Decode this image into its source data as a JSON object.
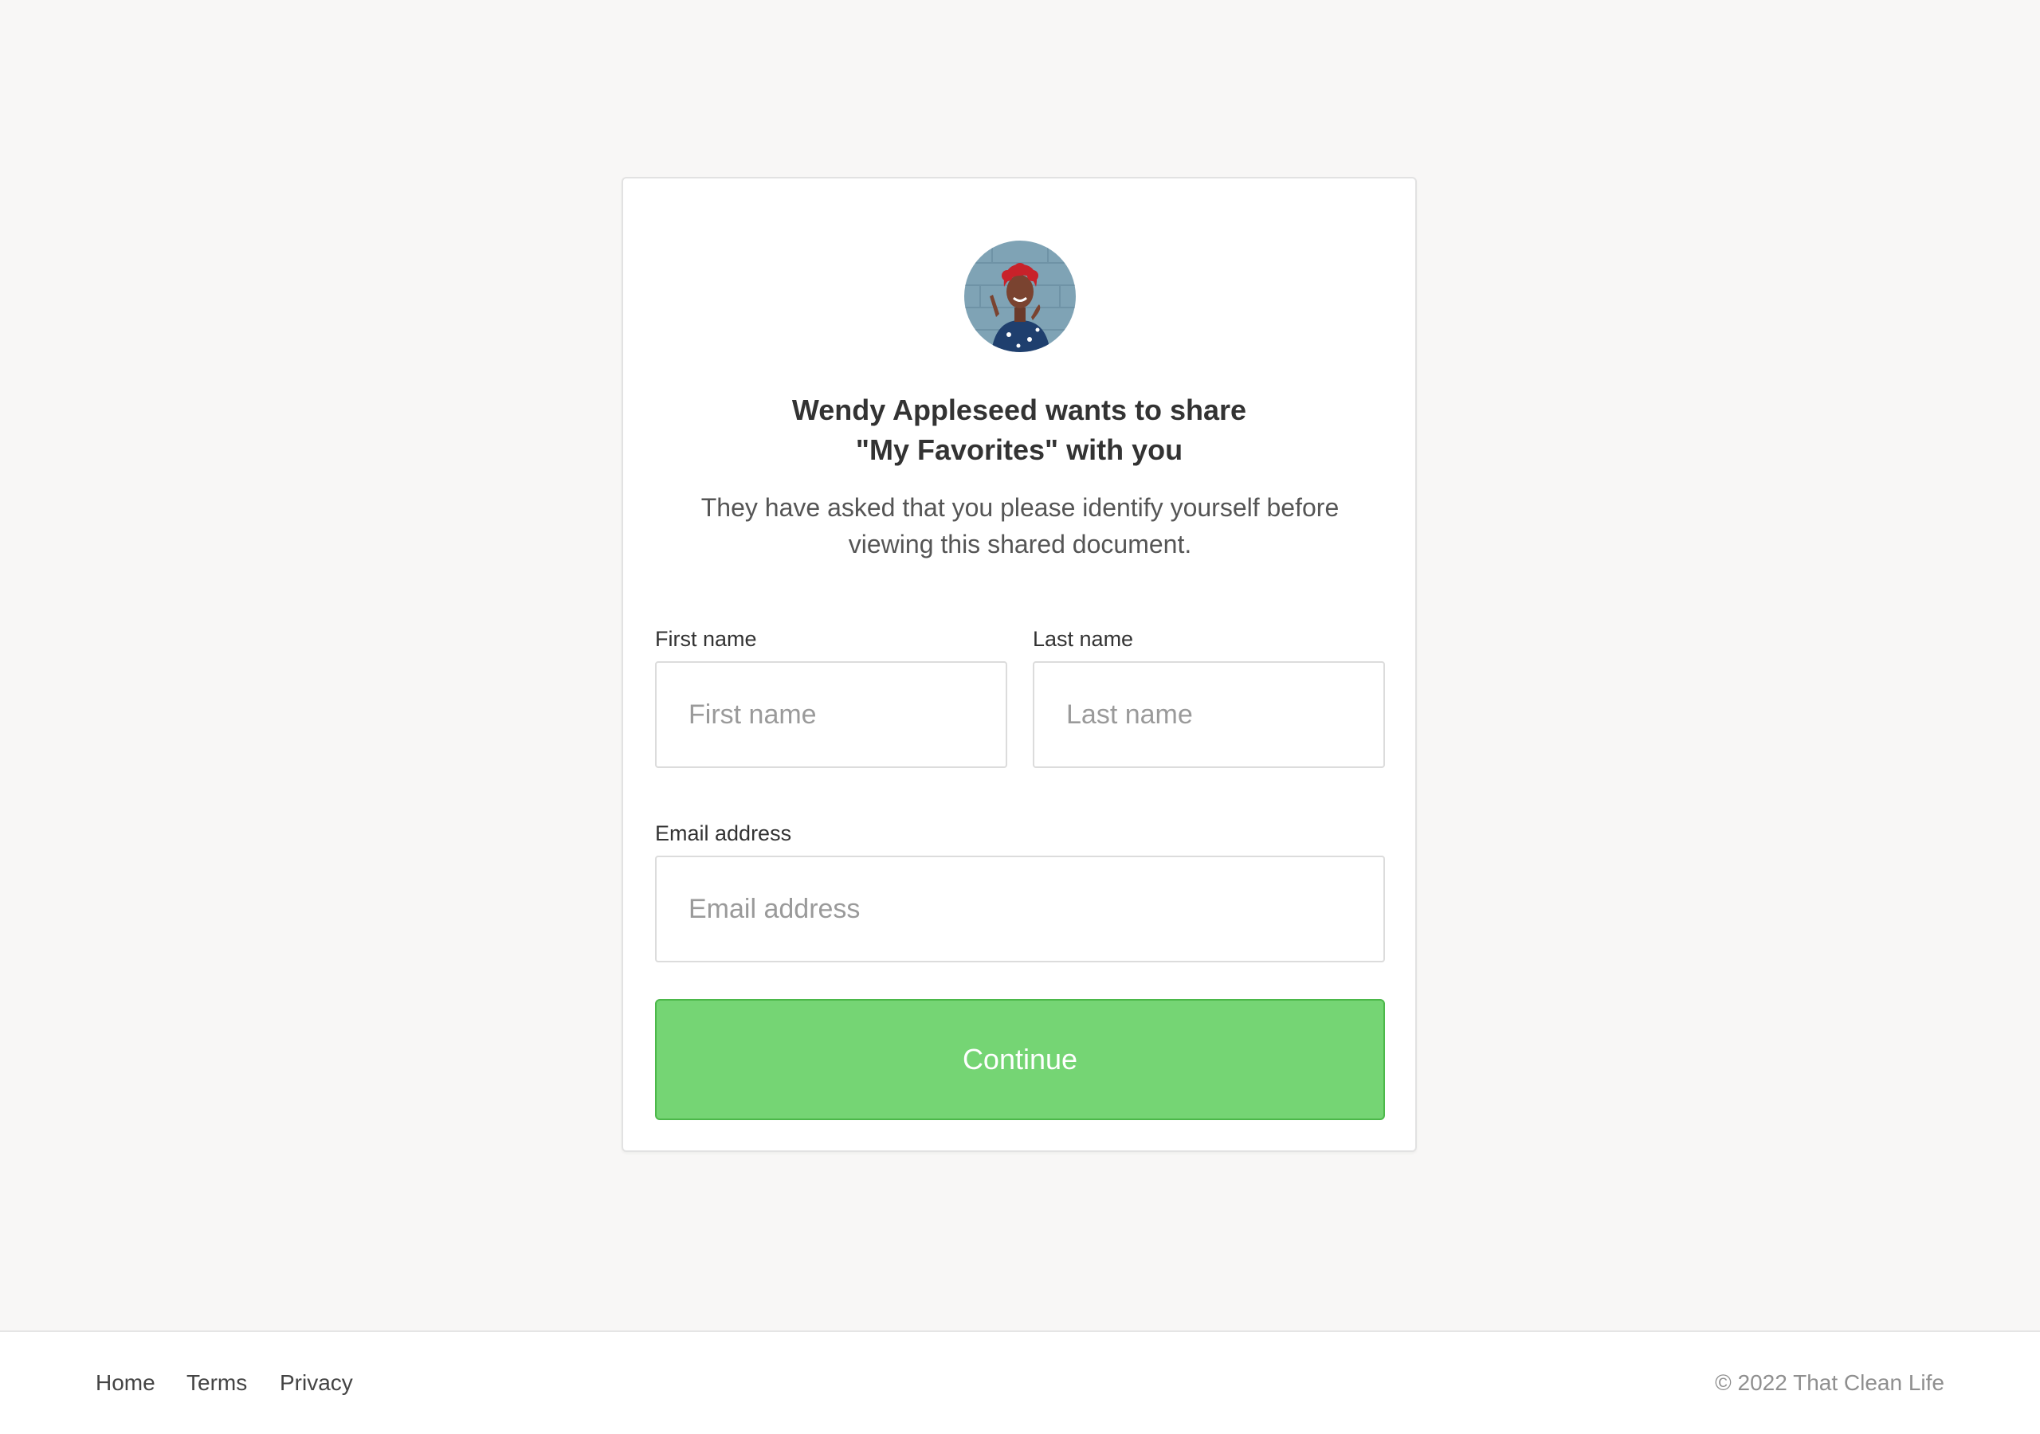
{
  "share": {
    "avatar_icon": "user-photo-avatar",
    "title_line1": "Wendy Appleseed wants to share",
    "title_line2": "\"My Favorites\" with you",
    "subtitle_line1": "They have asked that you please identify yourself before",
    "subtitle_line2": "viewing this shared document."
  },
  "form": {
    "first_name_label": "First name",
    "first_name_placeholder": "First name",
    "first_name_value": "",
    "last_name_label": "Last name",
    "last_name_placeholder": "Last name",
    "last_name_value": "",
    "email_label": "Email address",
    "email_placeholder": "Email address",
    "email_value": "",
    "continue_label": "Continue"
  },
  "footer": {
    "links": [
      "Home",
      "Terms",
      "Privacy"
    ],
    "copyright": "© 2022 That Clean Life"
  },
  "colors": {
    "page_background": "#f8f7f6",
    "button_green": "#75d574",
    "button_border": "#4cb84a"
  }
}
